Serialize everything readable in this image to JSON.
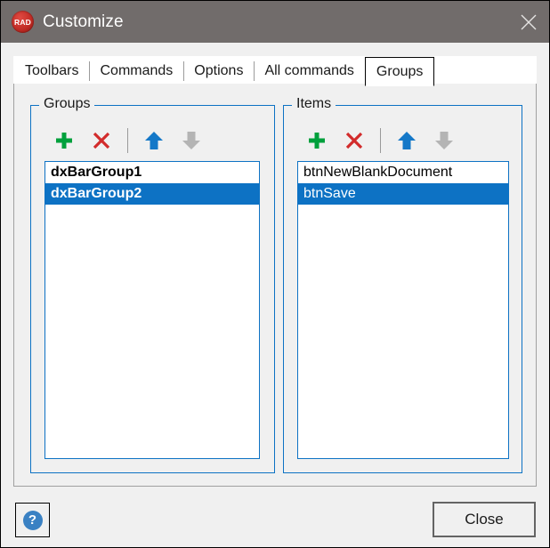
{
  "window": {
    "title": "Customize",
    "app_icon": "rad-logo-icon",
    "app_icon_text": "RAD",
    "close_icon": "close-icon",
    "titlebar_color": "#716c6b"
  },
  "tabs": [
    {
      "label": "Toolbars",
      "selected": false
    },
    {
      "label": "Commands",
      "selected": false
    },
    {
      "label": "Options",
      "selected": false
    },
    {
      "label": "All commands",
      "selected": false
    },
    {
      "label": "Groups",
      "selected": true
    }
  ],
  "groups_panel": {
    "caption": "Groups",
    "toolbar": [
      {
        "name": "add-group-button",
        "icon": "plus-icon",
        "color": "#00a03c",
        "enabled": true
      },
      {
        "name": "delete-group-button",
        "icon": "cross-icon",
        "color": "#d22b2b",
        "enabled": true
      },
      {
        "name": "toolbar-separator",
        "icon": "separator",
        "color": "#9a9a9a",
        "enabled": false
      },
      {
        "name": "move-group-up-button",
        "icon": "arrow-up-icon",
        "color": "#1478c8",
        "enabled": true
      },
      {
        "name": "move-group-down-button",
        "icon": "arrow-down-icon",
        "color": "#b4b4b4",
        "enabled": false
      }
    ],
    "items": [
      {
        "label": "dxBarGroup1",
        "selected": false
      },
      {
        "label": "dxBarGroup2",
        "selected": true
      }
    ]
  },
  "items_panel": {
    "caption": "Items",
    "toolbar": [
      {
        "name": "add-item-button",
        "icon": "plus-icon",
        "color": "#00a03c",
        "enabled": true
      },
      {
        "name": "delete-item-button",
        "icon": "cross-icon",
        "color": "#d22b2b",
        "enabled": true
      },
      {
        "name": "toolbar-separator",
        "icon": "separator",
        "color": "#9a9a9a",
        "enabled": false
      },
      {
        "name": "move-item-up-button",
        "icon": "arrow-up-icon",
        "color": "#1478c8",
        "enabled": true
      },
      {
        "name": "move-item-down-button",
        "icon": "arrow-down-icon",
        "color": "#b4b4b4",
        "enabled": false
      }
    ],
    "items": [
      {
        "label": "btnNewBlankDocument",
        "selected": false
      },
      {
        "label": "btnSave",
        "selected": true
      }
    ]
  },
  "footer": {
    "help_label": "?",
    "help_icon": "question-mark-icon",
    "close_label": "Close"
  },
  "colors": {
    "accent": "#0d72c4",
    "selection": "#0d72c4",
    "dialog_face": "#f0f0f0",
    "titlebar": "#716c6b"
  }
}
